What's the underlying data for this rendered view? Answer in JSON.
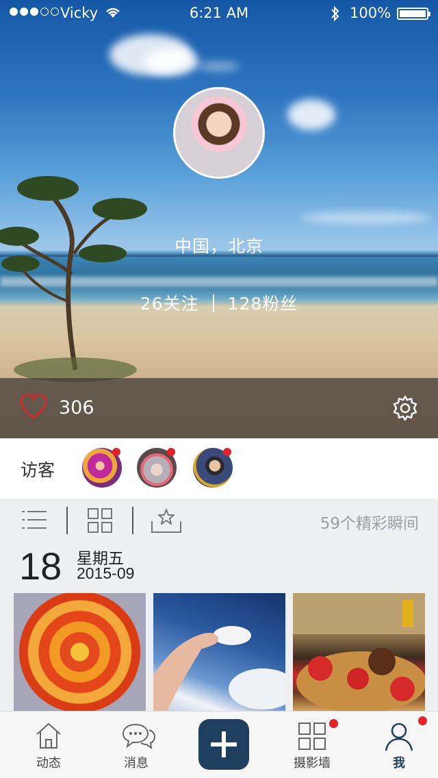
{
  "status_bar": {
    "carrier": "Vicky",
    "time": "6:21 AM",
    "battery": "100%"
  },
  "profile": {
    "location": "中国，北京",
    "following": "26关注",
    "followers": "128粉丝",
    "likes": "306"
  },
  "visitors": {
    "label": "访客",
    "count_shown": 3
  },
  "toolbar": {
    "moments": "59个精彩瞬间"
  },
  "date": {
    "day": "18",
    "weekday": "星期五",
    "year_month": "2015-09"
  },
  "tabs": [
    {
      "label": "动态",
      "icon": "home-icon"
    },
    {
      "label": "消息",
      "icon": "chat-bubbles-icon"
    },
    {
      "label": "",
      "icon": "plus-icon"
    },
    {
      "label": "摄影墙",
      "icon": "grid-icon"
    },
    {
      "label": "我",
      "icon": "person-icon"
    }
  ],
  "colors": {
    "accent": "#1f3f5e",
    "badge": "#e5222a",
    "like": "#e5222a"
  }
}
